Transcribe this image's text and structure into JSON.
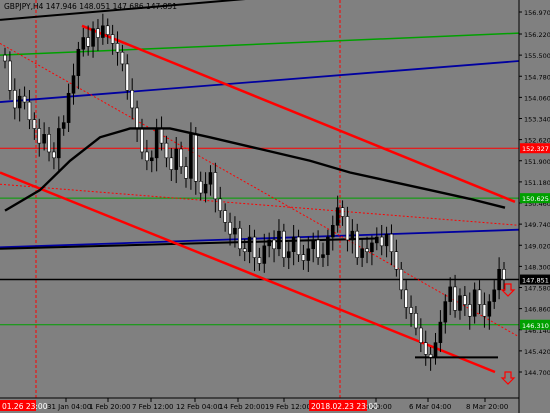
{
  "header": {
    "symbol_line": "GBPJPY,H4  147.946 148.051 147.686 147.851"
  },
  "chart_data": {
    "type": "candlestick",
    "symbol": "GBPJPY",
    "timeframe": "H4",
    "ohlc": {
      "open": 147.946,
      "high": 148.051,
      "low": 147.686,
      "close": 147.851
    },
    "ylim": [
      144.53,
      157.12
    ],
    "y_ticks": [
      156.97,
      156.22,
      155.5,
      154.78,
      154.06,
      153.34,
      152.62,
      151.9,
      151.18,
      150.46,
      149.74,
      149.02,
      148.3,
      147.58,
      146.86,
      146.14,
      145.42,
      144.7
    ],
    "x_ticks": [
      "31 Jan 04:00",
      "1 Feb 20:00",
      "7 Feb 12:00",
      "12 Feb 04:00",
      "14 Feb 20:00",
      "19 Feb 12:00",
      "Feb 20:00",
      "6 Mar 04:00",
      "8 Mar 20:00"
    ],
    "x_highlight_left": "01.26 23:00",
    "x_highlight_mid": "2018.02.23 23:00",
    "price_labels": [
      {
        "value": "152.327",
        "price": 152.327,
        "bg": "#ff0000"
      },
      {
        "value": "150.625",
        "price": 150.625,
        "bg": "#00a000"
      },
      {
        "value": "147.851",
        "price": 147.851,
        "bg": "#000000"
      },
      {
        "value": "146.310",
        "price": 146.31,
        "bg": "#00a000"
      }
    ],
    "close_series": [
      155.3,
      154.3,
      153.7,
      154.1,
      153.9,
      153.3,
      153.0,
      152.5,
      152.8,
      152.2,
      152.0,
      153.0,
      153.2,
      154.2,
      154.8,
      155.7,
      156.1,
      155.8,
      156.4,
      156.1,
      156.5,
      156.2,
      155.9,
      155.6,
      155.2,
      154.3,
      153.7,
      153.0,
      152.2,
      151.9,
      152.0,
      153.0,
      152.5,
      152.0,
      151.6,
      152.3,
      151.7,
      151.3,
      152.8,
      151.2,
      150.8,
      151.1,
      151.5,
      150.6,
      150.2,
      149.8,
      149.4,
      149.6,
      148.9,
      148.8,
      149.3,
      148.6,
      148.4,
      149.0,
      149.2,
      148.9,
      149.5,
      148.6,
      148.8,
      149.3,
      148.7,
      148.5,
      148.9,
      149.2,
      148.6,
      148.7,
      149.3,
      149.7,
      150.3,
      150.0,
      149.2,
      149.5,
      148.6,
      148.9,
      148.8,
      149.1,
      149.3,
      149.0,
      149.4,
      148.8,
      148.2,
      147.5,
      146.9,
      146.7,
      146.2,
      145.7,
      145.3,
      145.2,
      145.7,
      146.4,
      147.1,
      147.6,
      146.8,
      147.3,
      147.0,
      146.6,
      147.5,
      147.0,
      146.6,
      147.1,
      147.5,
      148.2,
      147.85
    ]
  },
  "colors": {
    "background": "#808080",
    "grid": "#6a6a6a",
    "red": "#ff0000",
    "green": "#00a000",
    "blue": "#0000a0",
    "black": "#000000",
    "candle_up": "#000000",
    "candle_down": "#ffffff",
    "down_arrow": "#ff0000"
  }
}
